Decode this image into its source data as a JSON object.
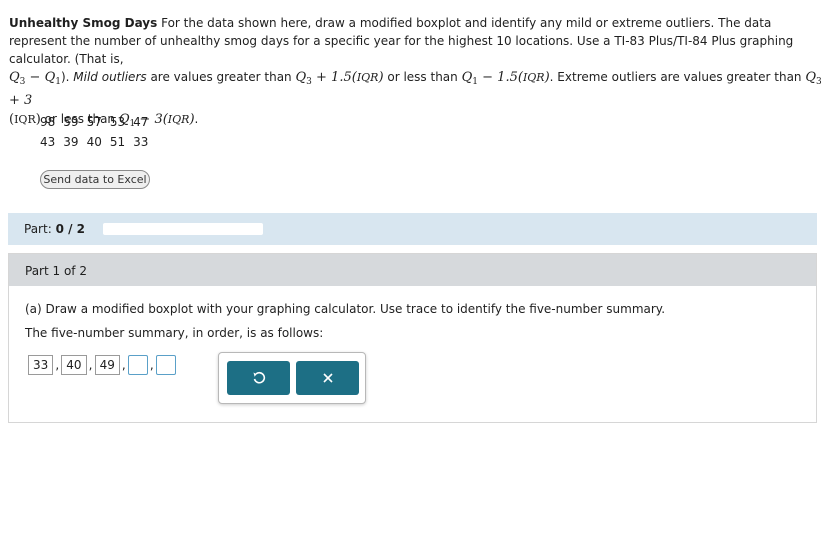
{
  "problem": {
    "title": "Unhealthy Smog Days",
    "text1": "For the data shown here, draw a modified boxplot and identify any mild or extreme outliers. The data represent the number of unhealthy smog days for a specific year for the highest 10 locations. Use a TI-83 Plus/TI-84 Plus graphing calculator. (That is,",
    "mild_label": "Mild outliers",
    "mild_text_a": "are values greater than",
    "mild_text_b": "or less than",
    "extreme_text": ". Extreme outliers are values greater than",
    "extreme_text_b": "or less than",
    "iqr": "IQR",
    "q1": "Q",
    "coef_mild": "1.5",
    "coef_extreme": "3"
  },
  "dataset": {
    "rows": [
      [
        "98",
        "59",
        "57",
        "53",
        "47"
      ],
      [
        "43",
        "39",
        "40",
        "51",
        "33"
      ]
    ]
  },
  "excel_button": "Send data to Excel",
  "part_bar": {
    "label": "Part:",
    "value": "0 / 2",
    "progress": 0
  },
  "panel": {
    "header": "Part 1 of 2",
    "question": "(a) Draw a modified boxplot with your graphing calculator. Use trace to identify the five-number summary.",
    "summary_label": "The five-number summary, in order, is as follows:",
    "answers": [
      "33",
      "40",
      "49",
      "",
      ""
    ]
  },
  "colors": {
    "accent": "#1d6f85",
    "part_bar_bg": "#d8e6f0",
    "header_bg": "#d6d9dc"
  },
  "icons": {
    "undo": "undo-icon",
    "clear": "close-icon"
  }
}
